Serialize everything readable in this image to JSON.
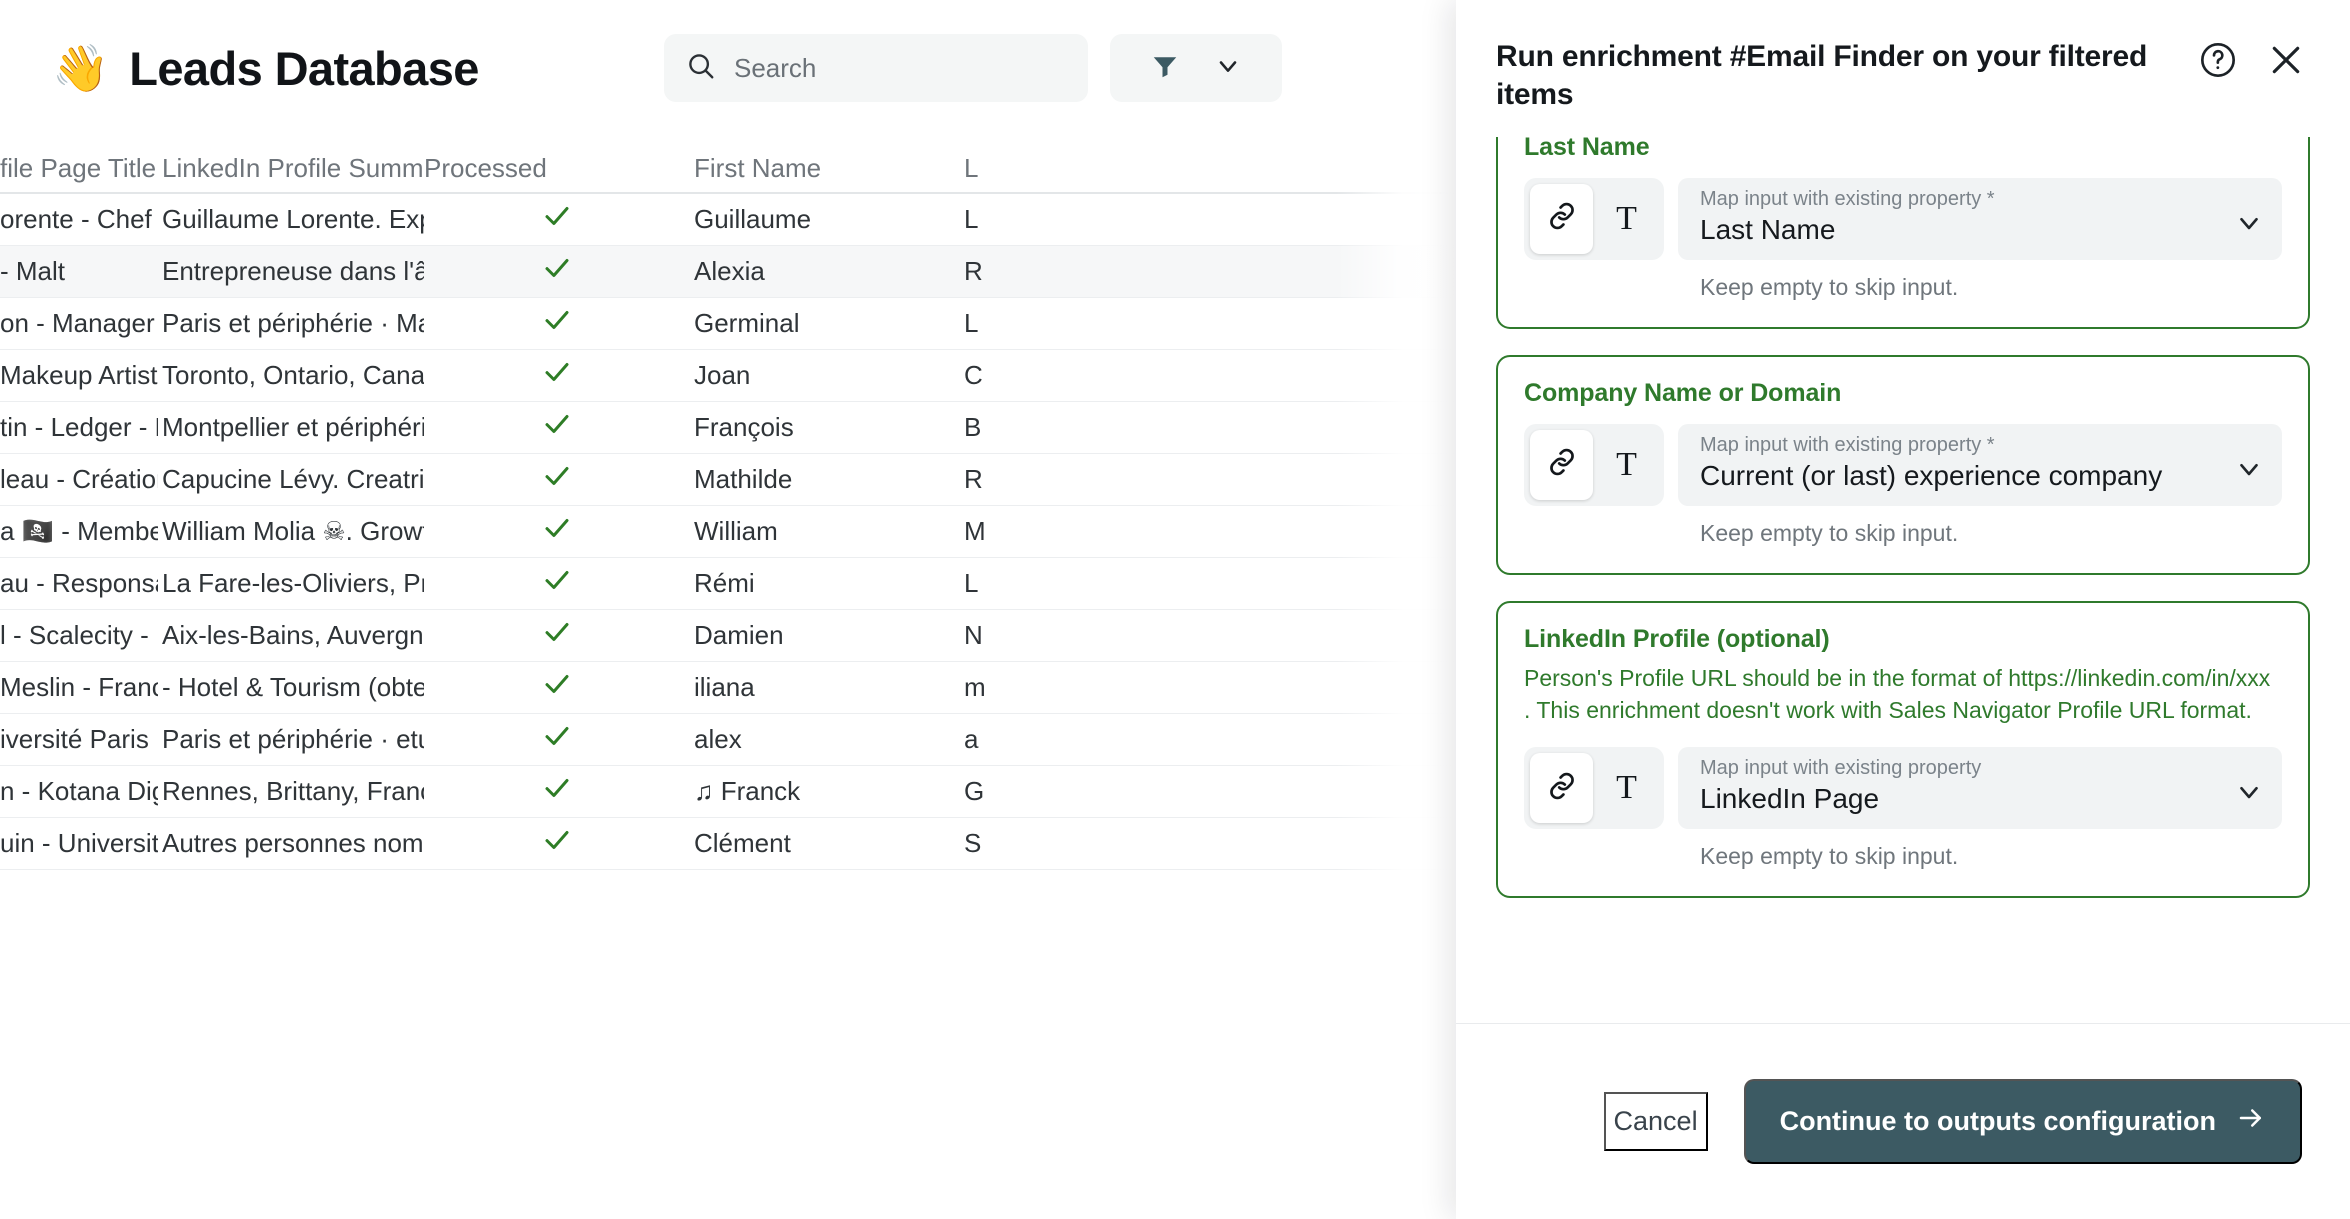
{
  "header": {
    "emoji": "👋",
    "title": "Leads Database",
    "search": {
      "placeholder": "Search",
      "icon": "search-icon",
      "value": ""
    },
    "filter": {
      "icon": "filter-icon",
      "chevron": "chevron-down-icon"
    }
  },
  "table": {
    "columns": [
      "file Page Title",
      "LinkedIn Profile Summary",
      "Processed",
      "First Name",
      "L"
    ],
    "rows": [
      {
        "title": "orente - Chef d'e…",
        "summary": "Guillaume Lorente. Exploita…",
        "processed": "✓",
        "first": "Guillaume",
        "last": "L"
      },
      {
        "title": "- Malt",
        "summary": "Entrepreneuse dans l'âme, j'…",
        "processed": "✓",
        "first": "Alexia",
        "last": "R"
      },
      {
        "title": "on - Manager - …",
        "summary": "Paris et périphérie · Manage…",
        "processed": "✓",
        "first": "Germinal",
        "last": "L"
      },
      {
        "title": "Makeup Artist - …",
        "summary": "Toronto, Ontario, Canada · …",
        "processed": "✓",
        "first": "Joan",
        "last": "C"
      },
      {
        "title": "tin - Ledger - Li…",
        "summary": "Montpellier et périphérie · Fi…",
        "processed": "✓",
        "first": "François",
        "last": "B"
      },
      {
        "title": "leau - Création…",
        "summary": "Capucine Lévy. Creatrice de…",
        "processed": "✓",
        "first": "Mathilde",
        "last": "R"
      },
      {
        "title": "a 🏴‍☠️ - Member -…",
        "summary": "William Molia ☠. Growth Ha…",
        "processed": "✓",
        "first": "William",
        "last": "M"
      },
      {
        "title": "au - Responsab…",
        "summary": "La Fare-les-Oliviers, Provenc…",
        "processed": "✓",
        "first": "Rémi",
        "last": "L"
      },
      {
        "title": "l - Scalecity - Li…",
        "summary": "Aix-les-Bains, Auvergne-Rhô…",
        "processed": "✓",
        "first": "Damien",
        "last": "N"
      },
      {
        "title": " Meslin - Franc…",
        "summary": "- Hotel & Tourism (obtention…",
        "processed": "✓",
        "first": "iliana",
        "last": "m"
      },
      {
        "title": "iversité Paris …",
        "summary": "Paris et périphérie · etudiant…",
        "processed": "✓",
        "first": "alex",
        "last": "a"
      },
      {
        "title": "n - Kotana Digital",
        "summary": "Rennes, Brittany, France · K…",
        "processed": "✓",
        "first": "♫ Franck",
        "last": "G"
      },
      {
        "title": "uin - Université …",
        "summary": "Autres personnes nommée…",
        "processed": "✓",
        "first": "Clément",
        "last": "S"
      }
    ],
    "highlighted_row_index": 1,
    "check_color": "#2e7d26"
  },
  "panel": {
    "title": "Run enrichment #Email Finder on your filtered items",
    "help_icon": "help-circle-icon",
    "close_icon": "close-icon",
    "accent_color": "#2f7a2c",
    "fields": [
      {
        "label": "Last Name",
        "note": "",
        "link_icon": "link-icon",
        "text_icon": "text-format-icon",
        "select_label": "Map input with existing property *",
        "select_value": "Last Name",
        "chevron": "chevron-down-icon",
        "hint": "Keep empty to skip input.",
        "clipped": true
      },
      {
        "label": "Company Name or Domain",
        "note": "",
        "link_icon": "link-icon",
        "text_icon": "text-format-icon",
        "select_label": "Map input with existing property *",
        "select_value": "Current (or last) experience company",
        "chevron": "chevron-down-icon",
        "hint": "Keep empty to skip input.",
        "clipped": false
      },
      {
        "label": "LinkedIn Profile (optional)",
        "note": "Person's Profile URL should be in the format of https://linkedin.com/in/xxx . This enrichment doesn't work with Sales Navigator Profile URL format.",
        "link_icon": "link-icon",
        "text_icon": "text-format-icon",
        "select_label": "Map input with existing property",
        "select_value": "LinkedIn Page",
        "chevron": "chevron-down-icon",
        "hint": "Keep empty to skip input.",
        "clipped": false
      }
    ],
    "footer": {
      "cancel_label": "Cancel",
      "continue_label": "Continue to outputs configuration",
      "continue_icon": "arrow-right-icon",
      "primary_color": "#3c5a63"
    }
  }
}
